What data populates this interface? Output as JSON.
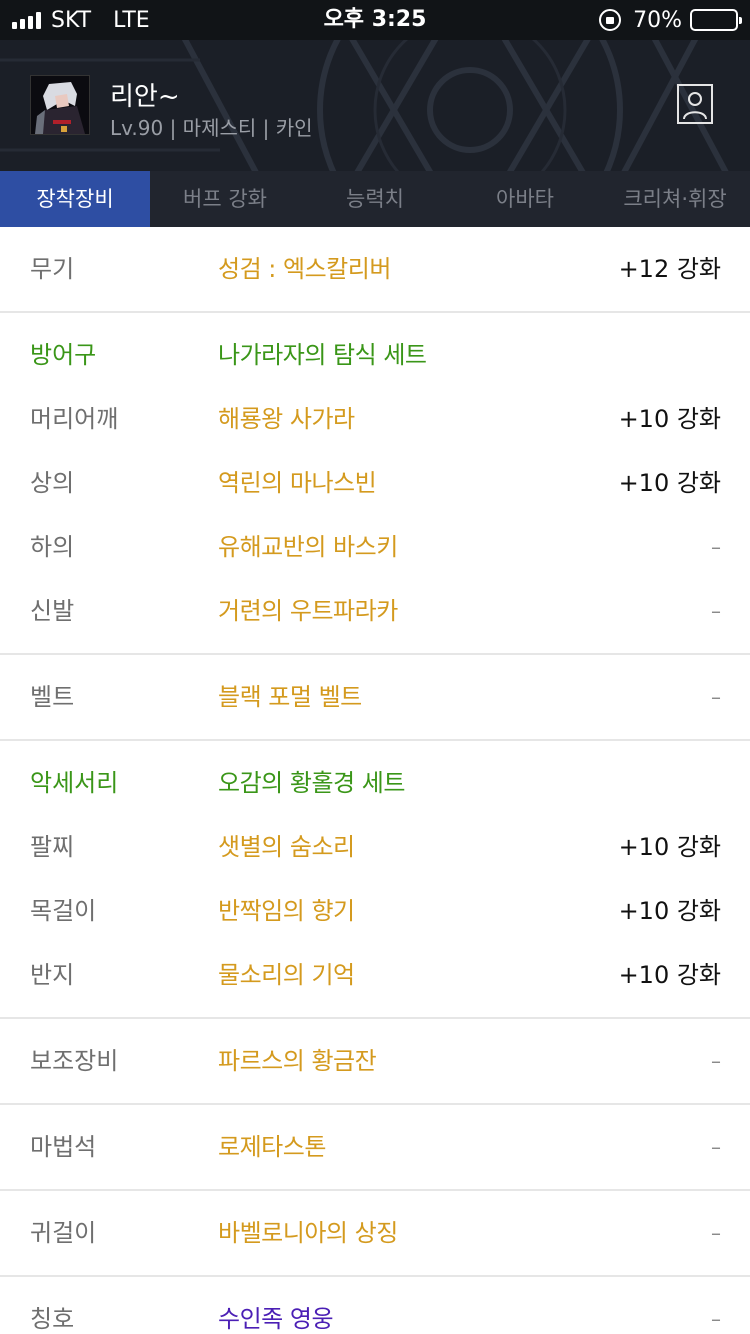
{
  "status_bar": {
    "carrier": "SKT",
    "network": "LTE",
    "time": "오후 3:25",
    "battery": "70%",
    "battery_level": 0.7
  },
  "profile": {
    "name": "리안~",
    "info": "Lv.90 | 마제스티 | 카인"
  },
  "tabs": [
    {
      "label": "장착장비",
      "active": true
    },
    {
      "label": "버프 강화",
      "active": false
    },
    {
      "label": "능력치",
      "active": false
    },
    {
      "label": "아바타",
      "active": false
    },
    {
      "label": "크리쳐·휘장",
      "active": false
    }
  ],
  "equipment": {
    "weapon": {
      "slot": "무기",
      "item": "성검 : 엑스칼리버",
      "enhance": "+12 강화"
    },
    "armor": {
      "group": "방어구",
      "set_name": "나가라자의 탐식 세트",
      "rows": [
        {
          "slot": "머리어깨",
          "item": "해룡왕 사가라",
          "enhance": "+10 강화"
        },
        {
          "slot": "상의",
          "item": "역린의 마나스빈",
          "enhance": "+10 강화"
        },
        {
          "slot": "하의",
          "item": "유해교반의 바스키",
          "enhance": "–"
        },
        {
          "slot": "신발",
          "item": "거련의 우트파라카",
          "enhance": "–"
        }
      ]
    },
    "belt": {
      "slot": "벨트",
      "item": "블랙 포멀 벨트",
      "enhance": "–"
    },
    "accessory": {
      "group": "악세서리",
      "set_name": "오감의 황홀경 세트",
      "rows": [
        {
          "slot": "팔찌",
          "item": "샛별의 숨소리",
          "enhance": "+10 강화"
        },
        {
          "slot": "목걸이",
          "item": "반짝임의 향기",
          "enhance": "+10 강화"
        },
        {
          "slot": "반지",
          "item": "물소리의 기억",
          "enhance": "+10 강화"
        }
      ]
    },
    "sub": {
      "slot": "보조장비",
      "item": "파르스의 황금잔",
      "enhance": "–"
    },
    "magic_stone": {
      "slot": "마법석",
      "item": "로제타스톤",
      "enhance": "–"
    },
    "earring": {
      "slot": "귀걸이",
      "item": "바벨로니아의 상징",
      "enhance": "–"
    },
    "title": {
      "slot": "칭호",
      "item": "수인족 영웅",
      "enhance": "–"
    }
  },
  "colors": {
    "tab_active": "#2e4ea3",
    "item_name": "#d49a1e",
    "group_label": "#3a9618",
    "title_item": "#4b1fb5"
  }
}
